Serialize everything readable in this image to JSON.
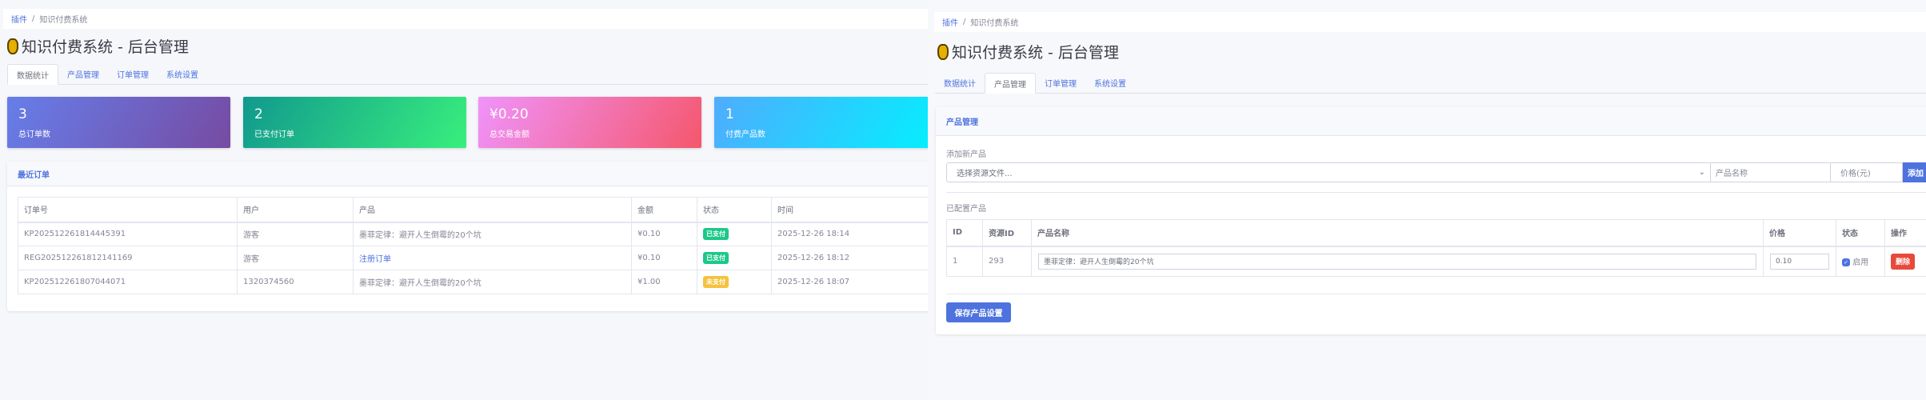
{
  "breadcrumb": {
    "root": "插件",
    "current": "知识付费系统"
  },
  "title": "知识付费系统 - 后台管理",
  "tabs": [
    "数据统计",
    "产品管理",
    "订单管理",
    "系统设置"
  ],
  "stats": [
    {
      "value": "3",
      "label": "总订单数",
      "from": "#667eea",
      "to": "#764ba2"
    },
    {
      "value": "2",
      "label": "已支付订单",
      "from": "#11998e",
      "to": "#38ef7d"
    },
    {
      "value": "¥0.20",
      "label": "总交易金额",
      "from": "#f093fb",
      "to": "#f5576c"
    },
    {
      "value": "1",
      "label": "付费产品数",
      "from": "#4facfe",
      "to": "#00f2fe"
    }
  ],
  "orders": {
    "title": "最近订单",
    "headers": [
      "订单号",
      "用户",
      "产品",
      "金额",
      "状态",
      "时间"
    ],
    "rows": [
      {
        "id": "KP20251226181444539​1",
        "user": "游客",
        "product": "墨菲定律：避开人生倒霉的20个坑",
        "amount": "¥0.10",
        "status": "已支付",
        "time": "2025-12-26 18:14",
        "link": false
      },
      {
        "id": "REG202512261812141169",
        "user": "游客",
        "product": "注册订单",
        "amount": "¥0.10",
        "status": "已支付",
        "time": "2025-12-26 18:12",
        "link": true
      },
      {
        "id": "KP202512261807044071",
        "user": "1320374560",
        "product": "墨菲定律：避开人生倒霉的20个坑",
        "amount": "¥1.00",
        "status": "未支付",
        "time": "2025-12-26 18:07",
        "link": false
      }
    ]
  },
  "products": {
    "title": "产品管理",
    "add_label": "添加新产品",
    "select_placeholder": "选择资源文件...",
    "name_placeholder": "产品名称",
    "price_placeholder": "价格(元)",
    "add_button": "添加",
    "configured_label": "已配置产品",
    "headers": [
      "ID",
      "资源ID",
      "产品名称",
      "价格",
      "状态",
      "操作"
    ],
    "rows": [
      {
        "id": "1",
        "resource_id": "293",
        "name": "墨菲定律：避开人生倒霉的20个坑",
        "price": "0.10",
        "status": "启用",
        "action": "删除"
      }
    ],
    "save_button": "保存产品设置"
  },
  "colors": {
    "primary": "#4e73df",
    "success": "#1cc88a",
    "warning": "#f6c23e",
    "danger": "#e74a3b"
  }
}
